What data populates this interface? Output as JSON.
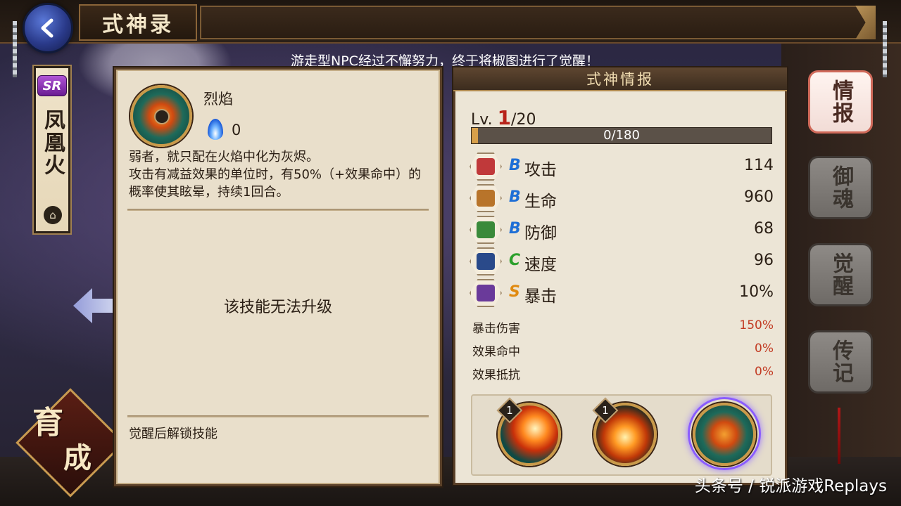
{
  "header": {
    "title": "式神录"
  },
  "announcement": "游走型NPC经过不懈努力，终于将椒图进行了觉醒！",
  "shikigami": {
    "rarity": "SR",
    "name": "凤凰火"
  },
  "nurture_label": {
    "line1": "育",
    "line2": "成"
  },
  "skill_panel": {
    "skill_name": "烈焰",
    "skill_cost": "0",
    "description": "弱者，就只配在火焰中化为灰烬。\n攻击有减益效果的单位时，有50%（+效果命中）的概率使其眩晕，持续1回合。",
    "no_upgrade_text": "该技能无法升级",
    "awaken_unlock_text": "觉醒后解锁技能"
  },
  "stat_panel": {
    "header": "式神情报",
    "level_prefix": "Lv.",
    "level_current": "1",
    "level_max": "/20",
    "exp_text": "0/180",
    "exp_fraction": 0.02,
    "stats": [
      {
        "icon": "attack-icon",
        "grade": "B",
        "grade_color": "#1f6fd6",
        "label": "攻击",
        "value": "114"
      },
      {
        "icon": "hp-icon",
        "grade": "B",
        "grade_color": "#1f6fd6",
        "label": "生命",
        "value": "960"
      },
      {
        "icon": "defense-icon",
        "grade": "B",
        "grade_color": "#1f6fd6",
        "label": "防御",
        "value": "68"
      },
      {
        "icon": "speed-icon",
        "grade": "C",
        "grade_color": "#2ca02c",
        "label": "速度",
        "value": "96"
      },
      {
        "icon": "crit-icon",
        "grade": "S",
        "grade_color": "#e08a10",
        "label": "暴击",
        "value": "10%"
      }
    ],
    "sub_stats": [
      {
        "label": "暴击伤害",
        "value": "150%"
      },
      {
        "label": "效果命中",
        "value": "0%"
      },
      {
        "label": "效果抵抗",
        "value": "0%"
      }
    ],
    "skill_levels": [
      "1",
      "1"
    ]
  },
  "tabs": [
    {
      "label": "情报",
      "active": true
    },
    {
      "label": "御魂",
      "active": false
    },
    {
      "label": "觉醒",
      "active": false
    },
    {
      "label": "传记",
      "active": false
    }
  ],
  "watermark": "头条号 / 锐派游戏Replays",
  "colors": {
    "accent_red": "#b8231a",
    "panel_bg": "#e9dfcb",
    "frame_brown": "#5a4028"
  }
}
